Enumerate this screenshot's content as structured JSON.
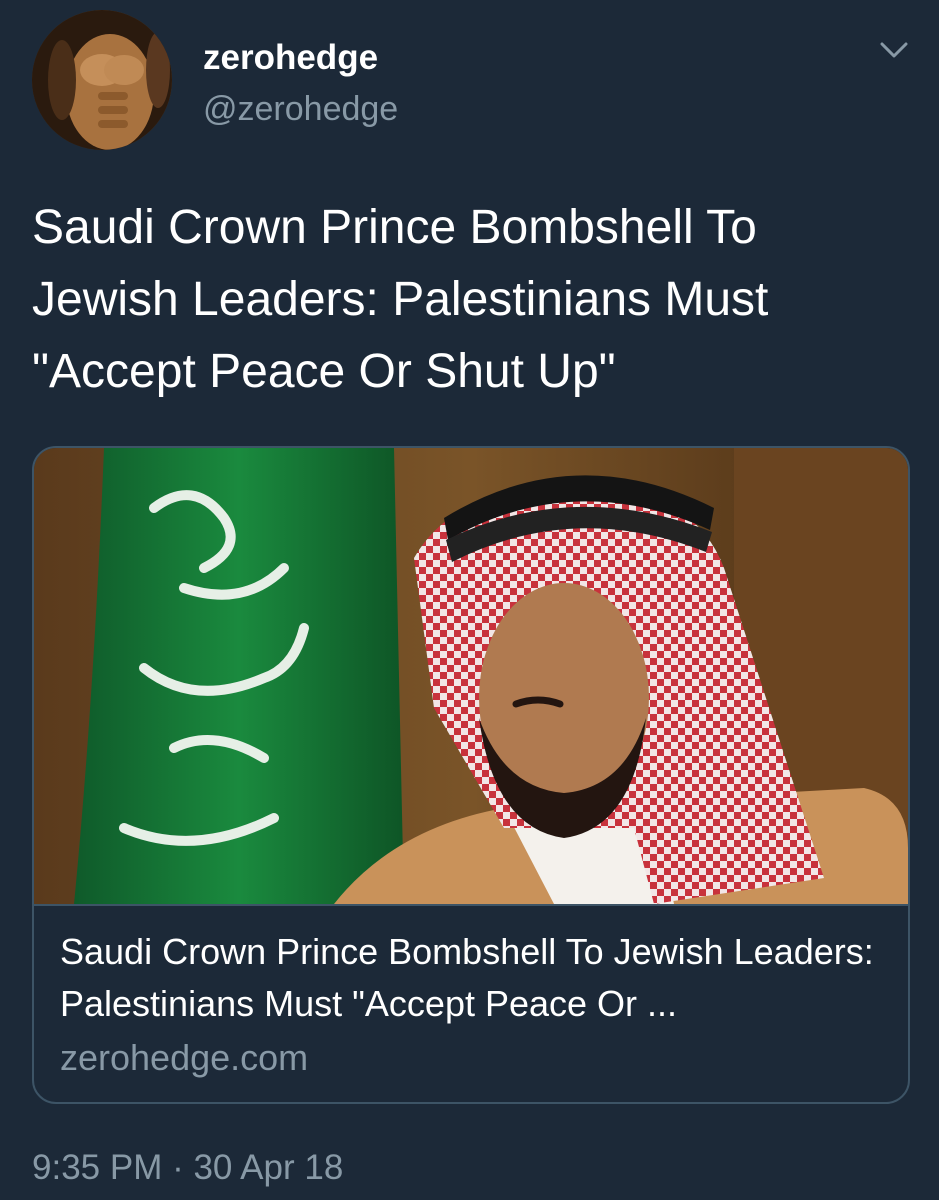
{
  "author": {
    "display_name": "zerohedge",
    "handle": "@zerohedge"
  },
  "tweet": {
    "text": "Saudi Crown Prince Bombshell To Jewish Leaders: Palestinians Must \"Accept Peace Or Shut Up\"",
    "timestamp": "9:35 PM · 30 Apr 18"
  },
  "card": {
    "title": "Saudi Crown Prince Bombshell To Jewish Leaders: Palestinians Must \"Accept Peace Or ...",
    "domain": "zerohedge.com"
  },
  "icons": {
    "menu": "chevron-down-icon"
  },
  "colors": {
    "background": "#1c2938",
    "secondary_text": "#8899a6",
    "card_border": "#3d5466"
  }
}
